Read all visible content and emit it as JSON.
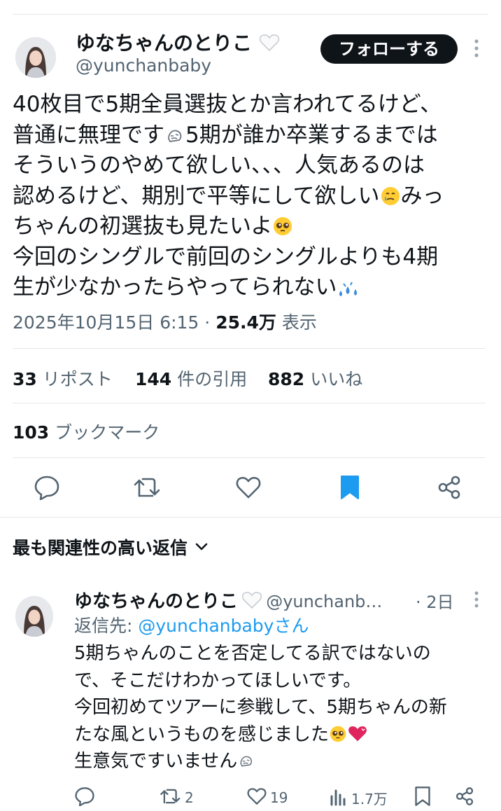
{
  "tweet": {
    "author_name": "ゆなちゃんのとりこ",
    "author_handle": "@yunchanbaby",
    "follow_label": "フォローする",
    "text_parts": [
      "40枚目で5期全員選抜とか言われてるけど、\n普通に無理です",
      "5期が誰か卒業するまでは\nそういうのやめて欲しい、、、人気あるのは\n認めるけど、期別で平等にして欲しい",
      "みっ\nちゃんの初選抜も見たいよ",
      "\n今回のシングルで前回のシングルよりも4期\n生が少なかったらやってられない"
    ],
    "timestamp": "2025年10月15日 6:15",
    "separator": "·",
    "views_count": "25.4万",
    "views_label": "表示",
    "stats": {
      "reposts_count": "33",
      "reposts_label": "リポスト",
      "quotes_count": "144",
      "quotes_label": "件の引用",
      "likes_count": "882",
      "likes_label": "いいね",
      "bookmarks_count": "103",
      "bookmarks_label": "ブックマーク"
    },
    "actions": [
      "reply-icon",
      "retweet-icon",
      "heart-icon",
      "bookmark-icon",
      "share-icon"
    ]
  },
  "replies_header": {
    "label": "最も関連性の高い返信"
  },
  "reply": {
    "author_name": "ゆなちゃんのとりこ",
    "author_handle": "@yunchanb…",
    "time": "· 2日",
    "replying_to_prefix": "返信先: ",
    "replying_to_handle": "@yunchanbabyさん",
    "text_parts": [
      "5期ちゃんのことを否定してる訳ではないの\nで、そこだけわかってほしいです。\n今回初めてツアーに参戦して、5期ちゃんの新\nたな風というものを感じました",
      "\n生意気ですいません"
    ],
    "reposts": "2",
    "likes": "19",
    "views": "1.7万"
  },
  "colors": {
    "text": "#0f1419",
    "secondary": "#536471",
    "link": "#1d9bf0",
    "divider": "#e5e7eb",
    "follow_bg": "#0f1419"
  }
}
